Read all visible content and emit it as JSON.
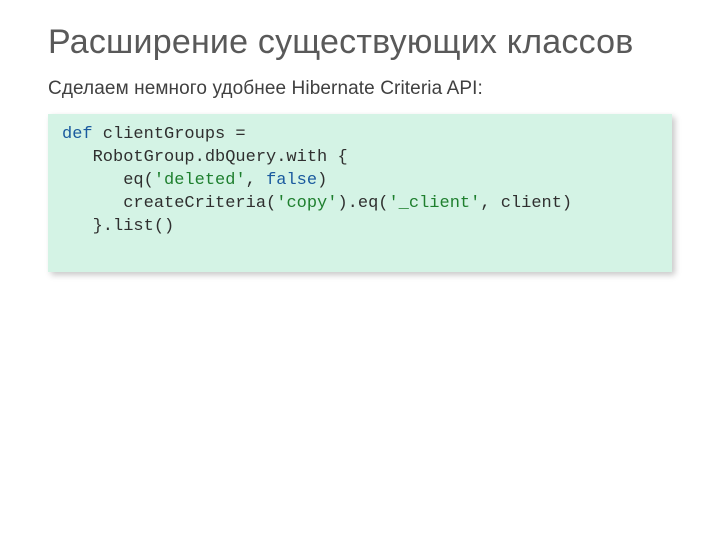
{
  "title": "Расширение существующих классов",
  "subtitle": "Сделаем немного удобнее Hibernate Criteria API:",
  "code": {
    "kw_def": "def",
    "l1_rest": " clientGroups =",
    "l2": "   RobotGroup.dbQuery.with {",
    "l3_a": "      eq(",
    "l3_str": "'deleted'",
    "l3_b": ", ",
    "l3_kw": "false",
    "l3_c": ")",
    "l4_a": "      createCriteria(",
    "l4_str1": "'copy'",
    "l4_b": ").eq(",
    "l4_str2": "'_client'",
    "l4_c": ", client)",
    "l5": "   }.list()"
  }
}
